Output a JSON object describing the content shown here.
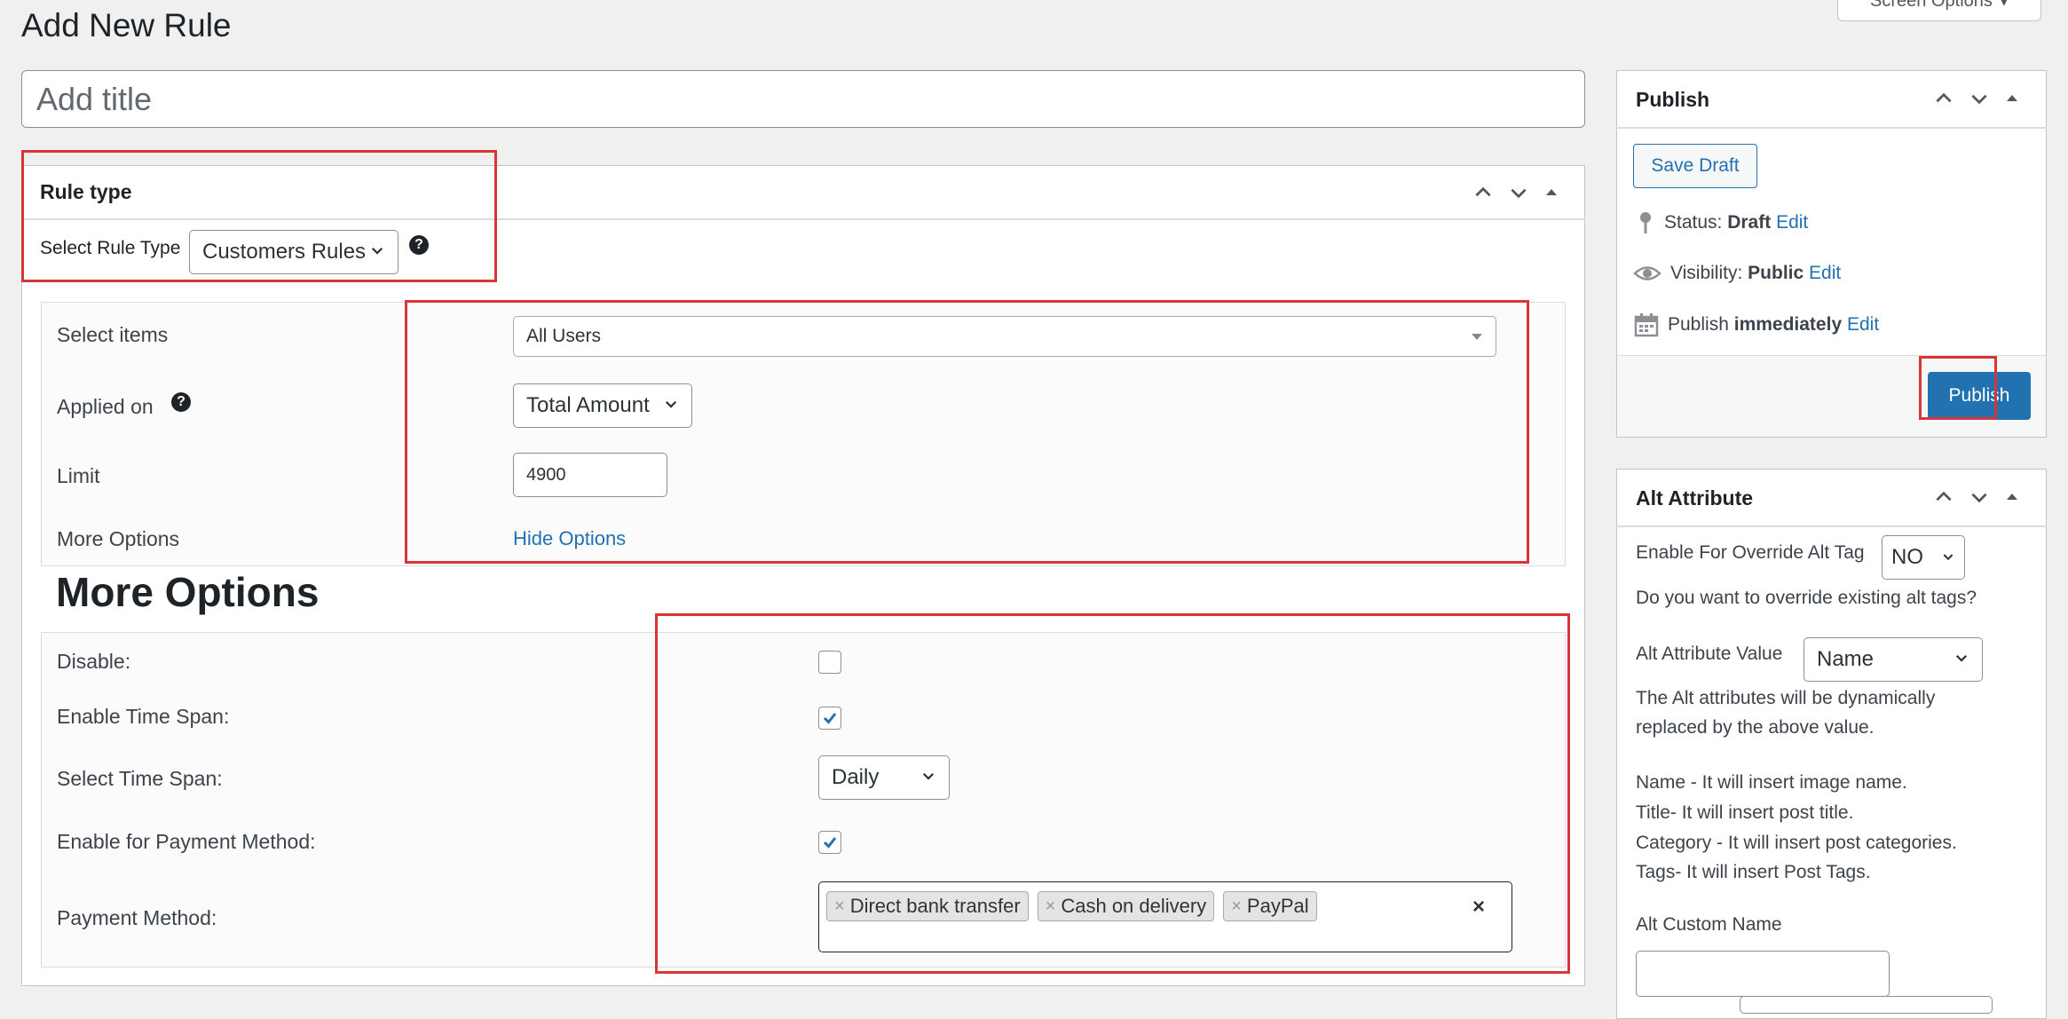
{
  "page": {
    "title": "Add New Rule",
    "screen_options": "Screen Options",
    "title_placeholder": "Add title"
  },
  "rule_type": {
    "title": "Rule type",
    "select_label": "Select Rule Type",
    "select_value": "Customers Rules"
  },
  "rule_fields": {
    "select_items_label": "Select items",
    "select_items_value": "All Users",
    "applied_on_label": "Applied on",
    "applied_on_value": "Total Amount",
    "limit_label": "Limit",
    "limit_value": "4900",
    "more_options_label": "More Options",
    "hide_options_link": "Hide Options"
  },
  "more_options": {
    "heading": "More Options",
    "disable_label": "Disable:",
    "time_span_label": "Enable Time Span:",
    "select_time_span_label": "Select Time Span:",
    "time_span_value": "Daily",
    "payment_enable_label": "Enable for Payment Method:",
    "payment_method_label": "Payment Method:",
    "payment_methods": [
      "Direct bank transfer",
      "Cash on delivery",
      "PayPal"
    ],
    "clear_symbol": "×",
    "tag_remove_symbol": "×"
  },
  "publish": {
    "title": "Publish",
    "save_draft": "Save Draft",
    "status_label": "Status:",
    "status_value": "Draft",
    "visibility_label": "Visibility:",
    "visibility_value": "Public",
    "publish_label": "Publish",
    "publish_value": "immediately",
    "edit": "Edit",
    "publish_button": "Publish"
  },
  "alt_attribute": {
    "title": "Alt Attribute",
    "override_label": "Enable For Override Alt Tag",
    "override_value": "NO",
    "override_question": "Do you want to override existing alt tags?",
    "value_label": "Alt Attribute Value",
    "value_select": "Name",
    "desc_line1": "The Alt attributes will be dynamically",
    "desc_line2": "replaced by the above value.",
    "help_name": "Name - It will insert image name.",
    "help_title": "Title- It will insert post title.",
    "help_category": "Category - It will insert post categories.",
    "help_tags": "Tags- It will insert Post Tags.",
    "custom_name_label": "Alt Custom Name"
  },
  "colors": {
    "accent": "#2271b1",
    "highlight_red": "#d63638",
    "background": "#f0f0f1"
  },
  "icons": [
    "chevron-up-icon",
    "chevron-down-icon",
    "triangle-up-icon",
    "help-icon",
    "pin-icon",
    "eye-icon",
    "calendar-icon",
    "checkmark-icon"
  ]
}
